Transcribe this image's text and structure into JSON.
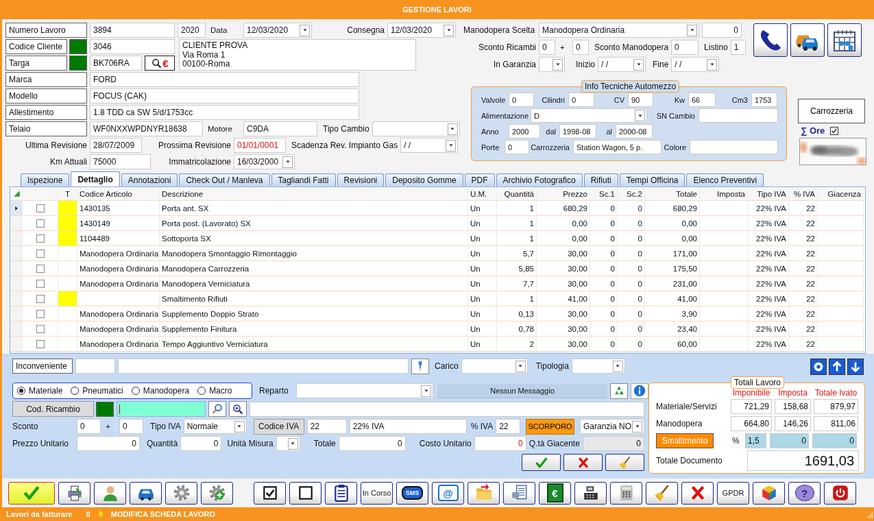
{
  "window": {
    "title": "GESTIONE LAVORI"
  },
  "job": {
    "numero": {
      "label": "Numero Lavoro",
      "value": "3894",
      "year": "2020"
    },
    "data": {
      "label": "Data",
      "value": "12/03/2020"
    },
    "consegna": {
      "label": "Consegna",
      "value": "12/03/2020"
    },
    "cliente": {
      "label": "Codice Cliente",
      "value": "3046"
    },
    "targa": {
      "label": "Targa",
      "value": "BK706RA",
      "lookup_symbol": "€"
    },
    "address": [
      "CLIENTE PROVA",
      "Via Roma 1",
      "00100-Roma"
    ]
  },
  "vehicle": {
    "marca": {
      "label": "Marca",
      "value": "FORD"
    },
    "modello": {
      "label": "Modello",
      "value": "FOCUS (CAK)"
    },
    "allestimento": {
      "label": "Allestimento",
      "value": "1.8 TDD ca SW 5/d/1753cc"
    },
    "telaio": {
      "label": "Telaio",
      "value": "WF0NXXWPDNYR18638"
    },
    "motore": {
      "label": "Motore",
      "value": "C9DA"
    },
    "tipo_cambio": {
      "label": "Tipo Cambio"
    },
    "ultima_revisione": {
      "label": "Ultima Revisione",
      "value": "28/07/2009"
    },
    "prossima_revisione": {
      "label": "Prossima Revisione",
      "value": "01/01/0001",
      "alert": true
    },
    "scadenza_gas": {
      "label": "Scadenza Rev. Impianto Gas",
      "value": "/ /"
    },
    "km": {
      "label": "Km Attuali",
      "value": "75000"
    },
    "immatricolazione": {
      "label": "Immatricolazione",
      "value": "16/03/2000"
    }
  },
  "labour": {
    "manodopera_scelta": {
      "label": "Manodopera Scelta",
      "value": "Manodopera Ordinaria",
      "amount": "0"
    },
    "sconto_ricambi": {
      "label": "Sconto Ricambi",
      "value_1": "0",
      "plus": "+",
      "value_2": "0"
    },
    "sconto_manodopera": {
      "label": "Sconto Manodopera",
      "value": "0"
    },
    "listino": {
      "label": "Listino",
      "value": "1"
    },
    "garanzia": {
      "label": "In Garanzia"
    },
    "inizio": {
      "label": "Inizio",
      "value": "/ /"
    },
    "fine": {
      "label": "Fine",
      "value": "/ /"
    }
  },
  "tech_info": {
    "title": "Info Tecniche Automezzo",
    "valvole": {
      "label": "Valvole",
      "value": "0"
    },
    "cilindri": {
      "label": "Cilindri",
      "value": "0"
    },
    "cv": {
      "label": "CV",
      "value": "90"
    },
    "kw": {
      "label": "Kw",
      "value": "66"
    },
    "cm3": {
      "label": "Cm3",
      "value": "1753"
    },
    "alimentazione": {
      "label": "Alimentazione",
      "value": "D"
    },
    "sn_cambio": {
      "label": "SN Cambio"
    },
    "anno": {
      "label": "Anno",
      "value": "2000"
    },
    "dal": {
      "label": "dal",
      "value": "1998-08"
    },
    "al": {
      "label": "al",
      "value": "2000-08"
    },
    "porte": {
      "label": "Porte",
      "value": "0"
    },
    "carrozzeria": {
      "label": "Carrozzeria",
      "value": "Station Wagon, 5 p."
    },
    "colore": {
      "label": "Colore"
    }
  },
  "side": {
    "carrozzeria_button": "Carrozzeria",
    "ore": {
      "label": "∑ Ore",
      "checked": true
    }
  },
  "tabs": [
    {
      "label": "Ispezione",
      "selected": false
    },
    {
      "label": "Dettaglio",
      "selected": true
    },
    {
      "label": "Annotazioni",
      "selected": false
    },
    {
      "label": "Check Out / Manleva",
      "selected": false
    },
    {
      "label": "Tagliandi Fatti",
      "selected": false
    },
    {
      "label": "Revisioni",
      "selected": false
    },
    {
      "label": "Deposito Gomme",
      "selected": false
    },
    {
      "label": "PDF",
      "selected": false
    },
    {
      "label": "Archivio Fotografico",
      "selected": false
    },
    {
      "label": "Rifiuti",
      "selected": false
    },
    {
      "label": "Tempi Officina",
      "selected": false
    },
    {
      "label": "Elenco Preventivi",
      "selected": false
    }
  ],
  "table": {
    "columns": [
      "T",
      "Codice Articolo",
      "Descrizione",
      "U.M.",
      "Quantità",
      "Prezzo",
      "Sc.1",
      "Sc.2",
      "Totale",
      "Imposta",
      "Tipo IVA",
      "% IVA",
      "Giacenza"
    ],
    "rows": [
      {
        "selected": true,
        "checked": false,
        "flagged": true,
        "code": "1430135",
        "description": "Porta ant. SX",
        "um": "Un",
        "qty": "1",
        "price": "680,29",
        "sc1": "0",
        "sc2": "0",
        "total": "680,29",
        "vat_type": "22% IVA",
        "vat_pct": "22"
      },
      {
        "selected": false,
        "checked": false,
        "flagged": true,
        "code": "1430149",
        "description": "Porta post. (Lavorato) SX",
        "um": "Un",
        "qty": "1",
        "price": "0,00",
        "sc1": "0",
        "sc2": "0",
        "total": "0,00",
        "vat_type": "22% IVA",
        "vat_pct": "22"
      },
      {
        "selected": false,
        "checked": false,
        "flagged": true,
        "code": "1104489",
        "description": "Sottoporta SX",
        "um": "Un",
        "qty": "1",
        "price": "0,00",
        "sc1": "0",
        "sc2": "0",
        "total": "0,00",
        "vat_type": "22% IVA",
        "vat_pct": "22"
      },
      {
        "selected": false,
        "checked": false,
        "flagged": false,
        "code": "Manodopera Ordinaria",
        "description": "Manodopera Smontaggio Rimontaggio",
        "um": "Un",
        "qty": "5,7",
        "price": "30,00",
        "sc1": "0",
        "sc2": "0",
        "total": "171,00",
        "vat_type": "22% IVA",
        "vat_pct": "22"
      },
      {
        "selected": false,
        "checked": false,
        "flagged": false,
        "code": "Manodopera Ordinaria",
        "description": "Manodopera Carrozzeria",
        "um": "Un",
        "qty": "5,85",
        "price": "30,00",
        "sc1": "0",
        "sc2": "0",
        "total": "175,50",
        "vat_type": "22% IVA",
        "vat_pct": "22"
      },
      {
        "selected": false,
        "checked": false,
        "flagged": false,
        "code": "Manodopera Ordinaria",
        "description": "Manodopera Verniciatura",
        "um": "Un",
        "qty": "7,7",
        "price": "30,00",
        "sc1": "0",
        "sc2": "0",
        "total": "231,00",
        "vat_type": "22% IVA",
        "vat_pct": "22"
      },
      {
        "selected": false,
        "checked": false,
        "flagged": true,
        "description": "Smaltimento Rifiuti",
        "um": "Un",
        "qty": "1",
        "price": "41,00",
        "sc1": "0",
        "sc2": "0",
        "total": "41,00",
        "vat_type": "22% IVA",
        "vat_pct": "22"
      },
      {
        "selected": false,
        "checked": false,
        "flagged": false,
        "code": "Manodopera Ordinaria",
        "description": "Supplemento Doppio Strato",
        "um": "Un",
        "qty": "0,13",
        "price": "30,00",
        "sc1": "0",
        "sc2": "0",
        "total": "3,90",
        "vat_type": "22% IVA",
        "vat_pct": "22"
      },
      {
        "selected": false,
        "checked": false,
        "flagged": false,
        "code": "Manodopera Ordinaria",
        "description": "Supplemento Finitura",
        "um": "Un",
        "qty": "0,78",
        "price": "30,00",
        "sc1": "0",
        "sc2": "0",
        "total": "23,40",
        "vat_type": "22% IVA",
        "vat_pct": "22"
      },
      {
        "selected": false,
        "checked": false,
        "flagged": false,
        "code": "Manodopera Ordinaria",
        "description": "Tempo Aggiuntivo Verniciatura",
        "um": "Un",
        "qty": "2",
        "price": "30,00",
        "sc1": "0",
        "sc2": "0",
        "total": "60,00",
        "vat_type": "22% IVA",
        "vat_pct": "22"
      }
    ]
  },
  "item_form": {
    "inconveniente": {
      "label": "Inconveniente"
    },
    "carico": {
      "label": "Carico"
    },
    "tipologia": {
      "label": "Tipologia"
    },
    "types": [
      {
        "label": "Materiale",
        "selected": true
      },
      {
        "label": "Pneumatici",
        "selected": false
      },
      {
        "label": "Manodopera",
        "selected": false
      },
      {
        "label": "Macro",
        "selected": false
      }
    ],
    "reparto": {
      "label": "Reparto"
    },
    "message": "Nessun Messaggio",
    "cod_ricambio": {
      "label": "Cod. Ricambio"
    },
    "sconto": {
      "label": "Sconto",
      "value_1": "0",
      "plus": "+",
      "value_2": "0"
    },
    "tipo_iva": {
      "label": "Tipo IVA",
      "value": "Normale"
    },
    "codice_iva": {
      "label": "Codice IVA",
      "value": "22",
      "description": "22% IVA"
    },
    "perc_iva": {
      "label": "% IVA",
      "value": "22"
    },
    "scorporo": "SCORPORO",
    "garanzia": {
      "value": "Garanzia NO"
    },
    "prezzo_unitario": {
      "label": "Prezzo Unitario",
      "value": "0"
    },
    "quantita": {
      "label": "Quantità",
      "value": "0"
    },
    "unita_misura": {
      "label": "Unità Misura"
    },
    "totale": {
      "label": "Totale",
      "value": "0"
    },
    "costo_unitario": {
      "label": "Costo Unitario",
      "value": "0",
      "alert": true
    },
    "giacente": {
      "label": "Q.tà Giacente",
      "value": "0"
    }
  },
  "totals": {
    "title": "Totali Lavoro",
    "headers": [
      "Imponibile",
      "Imposta",
      "Totale Ivato"
    ],
    "rows": [
      {
        "label": "Materiale/Servizi",
        "values": [
          "721,29",
          "158,68",
          "879,97"
        ]
      },
      {
        "label": "Manodopera",
        "values": [
          "664,80",
          "146,26",
          "811,06"
        ]
      }
    ],
    "smaltimento": {
      "label": "Smaltimento",
      "percent_sign": "%",
      "percent": "1,5",
      "values": [
        "0",
        "0"
      ]
    },
    "documento": {
      "label": "Totale Documento",
      "value": "1691,03"
    }
  },
  "toolbar": {
    "left": [
      {
        "kind": "icon"
      },
      {
        "kind": "icon"
      },
      {
        "kind": "icon"
      },
      {
        "kind": "icon"
      },
      {
        "kind": "icon"
      },
      {
        "kind": "icon"
      }
    ],
    "right": [
      {
        "kind": "icon"
      },
      {
        "kind": "icon"
      },
      {
        "kind": "icon"
      },
      {
        "kind": "text",
        "label": "In Corso"
      },
      {
        "kind": "glyph",
        "label": "SMS"
      },
      {
        "kind": "glyph",
        "label": "@"
      },
      {
        "kind": "icon"
      },
      {
        "kind": "icon"
      },
      {
        "kind": "glyph",
        "label": "€"
      },
      {
        "kind": "icon"
      },
      {
        "kind": "icon"
      },
      {
        "kind": "icon"
      },
      {
        "kind": "icon"
      },
      {
        "kind": "text",
        "label": "GPDR"
      },
      {
        "kind": "icon"
      },
      {
        "kind": "glyph",
        "label": "?"
      },
      {
        "kind": "icon"
      }
    ]
  },
  "status_bar": {
    "label": "Lavori da fatturare",
    "count": "0",
    "message": "MODIFICA SCHEDA LAVORO"
  }
}
